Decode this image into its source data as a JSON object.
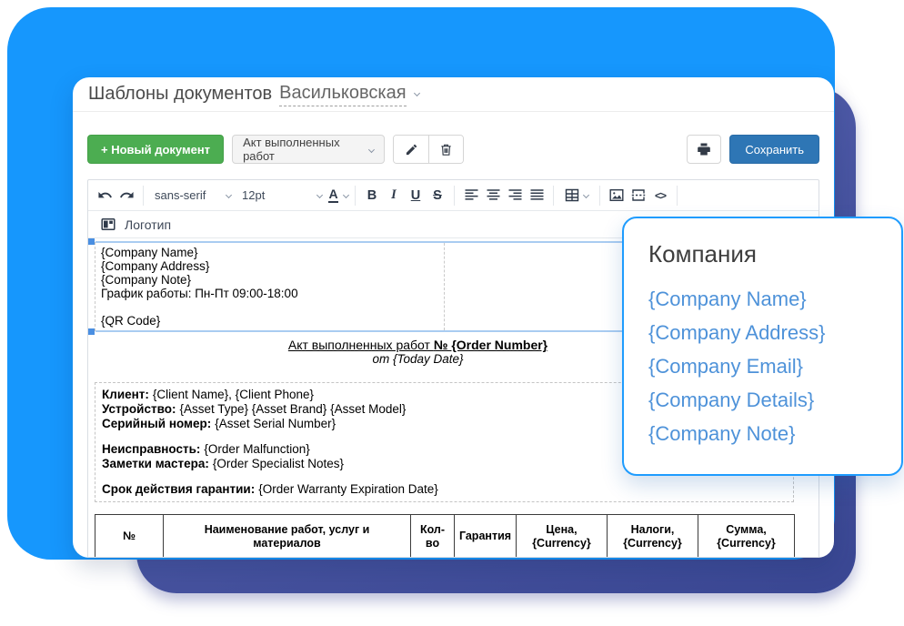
{
  "header": {
    "title": "Шаблоны документов",
    "branch": "Васильковская"
  },
  "toolbar": {
    "new_document": "+ Новый документ",
    "template_name": "Акт выполненных работ",
    "save": "Сохранить"
  },
  "editor": {
    "font_family": "sans-serif",
    "font_size": "12pt",
    "color_letter": "A",
    "bold": "B",
    "italic": "I",
    "underline": "U",
    "strike": "S",
    "code": "<>",
    "logo_button": "Логотип"
  },
  "doc": {
    "company_lines": [
      "{Company Name}",
      "{Company Address}",
      "{Company Note}",
      "График работы: Пн-Пт 09:00-18:00"
    ],
    "qr_line": "{QR Code}",
    "title_regular": "Акт выполненных работ ",
    "title_bold": "№ {Order Number}",
    "subtitle": "от {Today Date}",
    "fields": [
      {
        "label": "Клиент:",
        "value": "{Client Name}, {Client Phone}"
      },
      {
        "label": "Устройство:",
        "value": "{Asset Type} {Asset Brand} {Asset Model}"
      },
      {
        "label": "Серийный номер:",
        "value": "{Asset Serial Number}"
      },
      {
        "label": "Неисправность:",
        "value": "{Order Malfunction}"
      },
      {
        "label": "Заметки мастера:",
        "value": "{Order Specialist Notes}"
      },
      {
        "label": "Срок действия гарантии:",
        "value": "{Order Warranty Expiration Date}"
      }
    ],
    "table": {
      "headers": [
        {
          "line1": "№",
          "line2": ""
        },
        {
          "line1": "Наименование работ, услуг и",
          "line2": "материалов"
        },
        {
          "line1": "Кол-во",
          "line2": ""
        },
        {
          "line1": "Гарантия",
          "line2": ""
        },
        {
          "line1": "Цена,",
          "line2": "{Currency}"
        },
        {
          "line1": "Налоги,",
          "line2": "{Currency}"
        },
        {
          "line1": "Сумма,",
          "line2": "{Currency}"
        }
      ]
    }
  },
  "popup": {
    "title": "Компания",
    "items": [
      "{Company Name}",
      "{Company Address}",
      "{Company Email}",
      "{Company Details}",
      "{Company Note}"
    ]
  },
  "colors": {
    "accent_blue": "#1697fd",
    "accent_purple": "#47539f",
    "button_green": "#4cad51",
    "button_save": "#2e76b5",
    "popup_border": "#1f9cfe",
    "popup_link": "#4e92d9"
  }
}
